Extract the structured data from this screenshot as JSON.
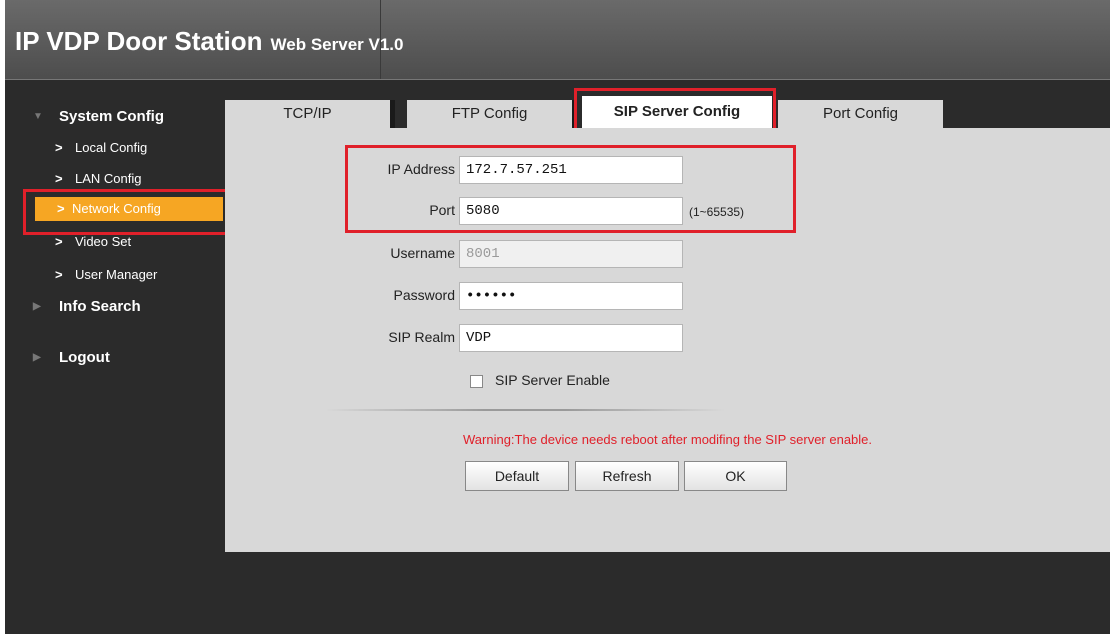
{
  "header": {
    "title": "IP VDP Door Station",
    "subtitle": "Web Server V1.0"
  },
  "sidebar": {
    "system_config": "System Config",
    "items": [
      {
        "label": "Local Config"
      },
      {
        "label": "LAN Config"
      },
      {
        "label": "Network Config"
      },
      {
        "label": "Video Set"
      },
      {
        "label": "User Manager"
      }
    ],
    "info_search": "Info Search",
    "logout": "Logout"
  },
  "tabs": [
    {
      "label": "TCP/IP"
    },
    {
      "label": "FTP Config"
    },
    {
      "label": "SIP Server Config"
    },
    {
      "label": "Port Config"
    }
  ],
  "form": {
    "ip_label": "IP Address",
    "ip_value": "172.7.57.251",
    "port_label": "Port",
    "port_value": "5080",
    "port_hint": "(1~65535)",
    "username_label": "Username",
    "username_value": "8001",
    "password_label": "Password",
    "password_value": "••••••",
    "realm_label": "SIP Realm",
    "realm_value": "VDP",
    "enable_label": "SIP Server Enable",
    "warning": "Warning:The device needs reboot after modifing the SIP server enable."
  },
  "buttons": {
    "default": "Default",
    "refresh": "Refresh",
    "ok": "OK"
  },
  "colors": {
    "accent": "#f6a623",
    "highlight_red": "#e0202a"
  }
}
